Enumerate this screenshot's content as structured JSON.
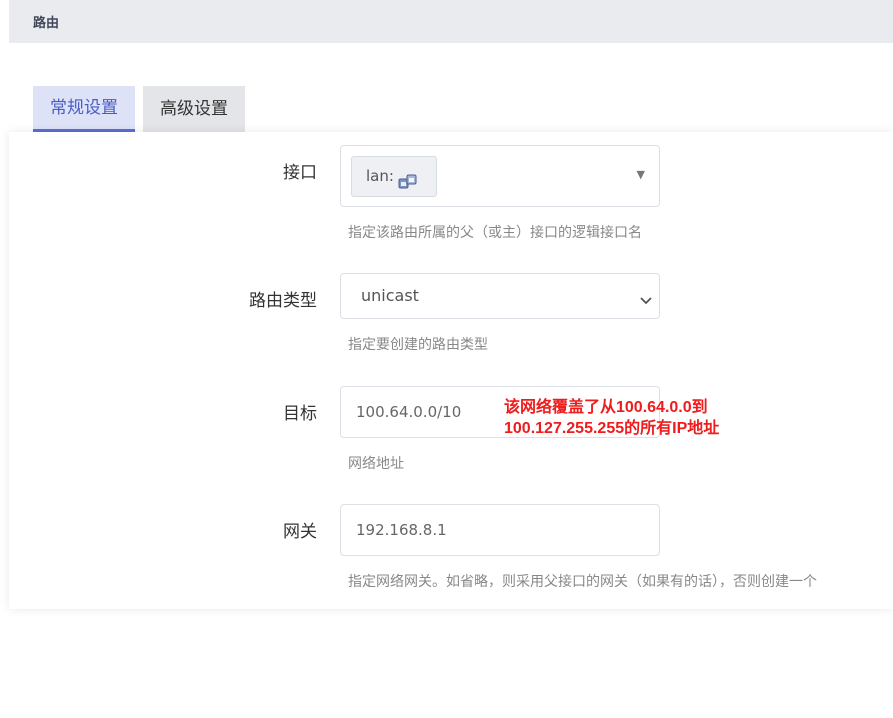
{
  "header": {
    "title": "路由"
  },
  "tabs": [
    {
      "label": "常规设置",
      "active": true
    },
    {
      "label": "高级设置",
      "active": false
    }
  ],
  "form": {
    "interface": {
      "label": "接口",
      "value": "lan:",
      "icon": "network-ports-icon",
      "help": "指定该路由所属的父（或主）接口的逻辑接口名"
    },
    "route_type": {
      "label": "路由类型",
      "value": "unicast",
      "help": "指定要创建的路由类型"
    },
    "target": {
      "label": "目标",
      "value": "100.64.0.0/10",
      "help": "网络地址"
    },
    "gateway": {
      "label": "网关",
      "value": "192.168.8.1",
      "help": "指定网络网关。如省略，则采用父接口的网关（如果有的话），否则创建一个"
    }
  },
  "annotation": {
    "line1": "该网络覆盖了从100.64.0.0到",
    "line2": "100.127.255.255的所有IP地址",
    "color": "#ee1c1c"
  },
  "colors": {
    "accent": "#5a6fd6",
    "header_bg": "#eaebef"
  }
}
